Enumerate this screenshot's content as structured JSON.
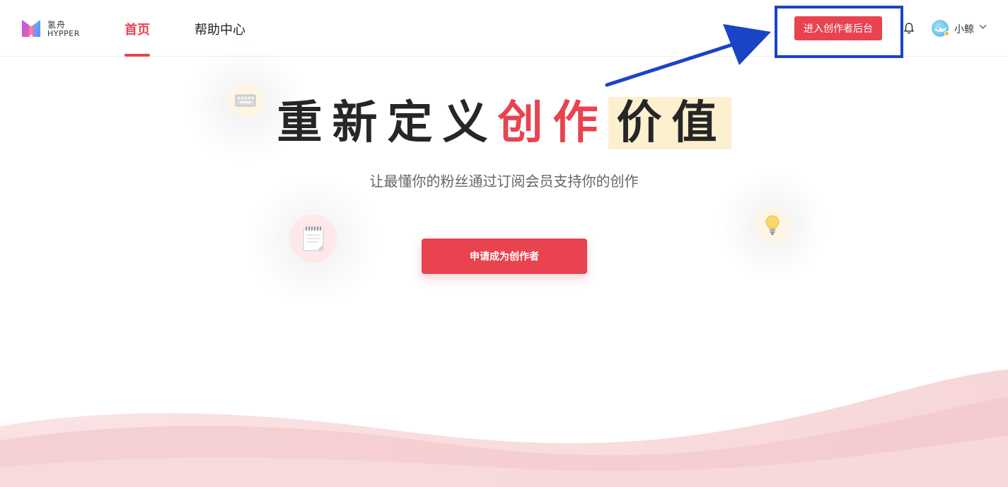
{
  "header": {
    "logo": {
      "cn": "氢舟",
      "en": "HYPPER"
    },
    "nav": [
      {
        "label": "首页",
        "active": true
      },
      {
        "label": "帮助中心",
        "active": false
      }
    ],
    "backend_button_label": "进入创作者后台",
    "user": {
      "name": "小鲸"
    }
  },
  "hero": {
    "title_part1": "重新定义",
    "title_accent": "创作",
    "title_highlight": "价值",
    "subtitle": "让最懂你的粉丝通过订阅会员支持你的创作",
    "cta_label": "申请成为创作者"
  },
  "icons": {
    "floating": [
      "keyboard-icon",
      "notepad-icon",
      "lightbulb-icon"
    ],
    "header": [
      "bell-icon",
      "chevron-down-icon"
    ]
  },
  "colors": {
    "brand_red": "#e8434f",
    "highlight_yellow": "#fdf0cf",
    "annotation_blue": "#1a44c6"
  }
}
